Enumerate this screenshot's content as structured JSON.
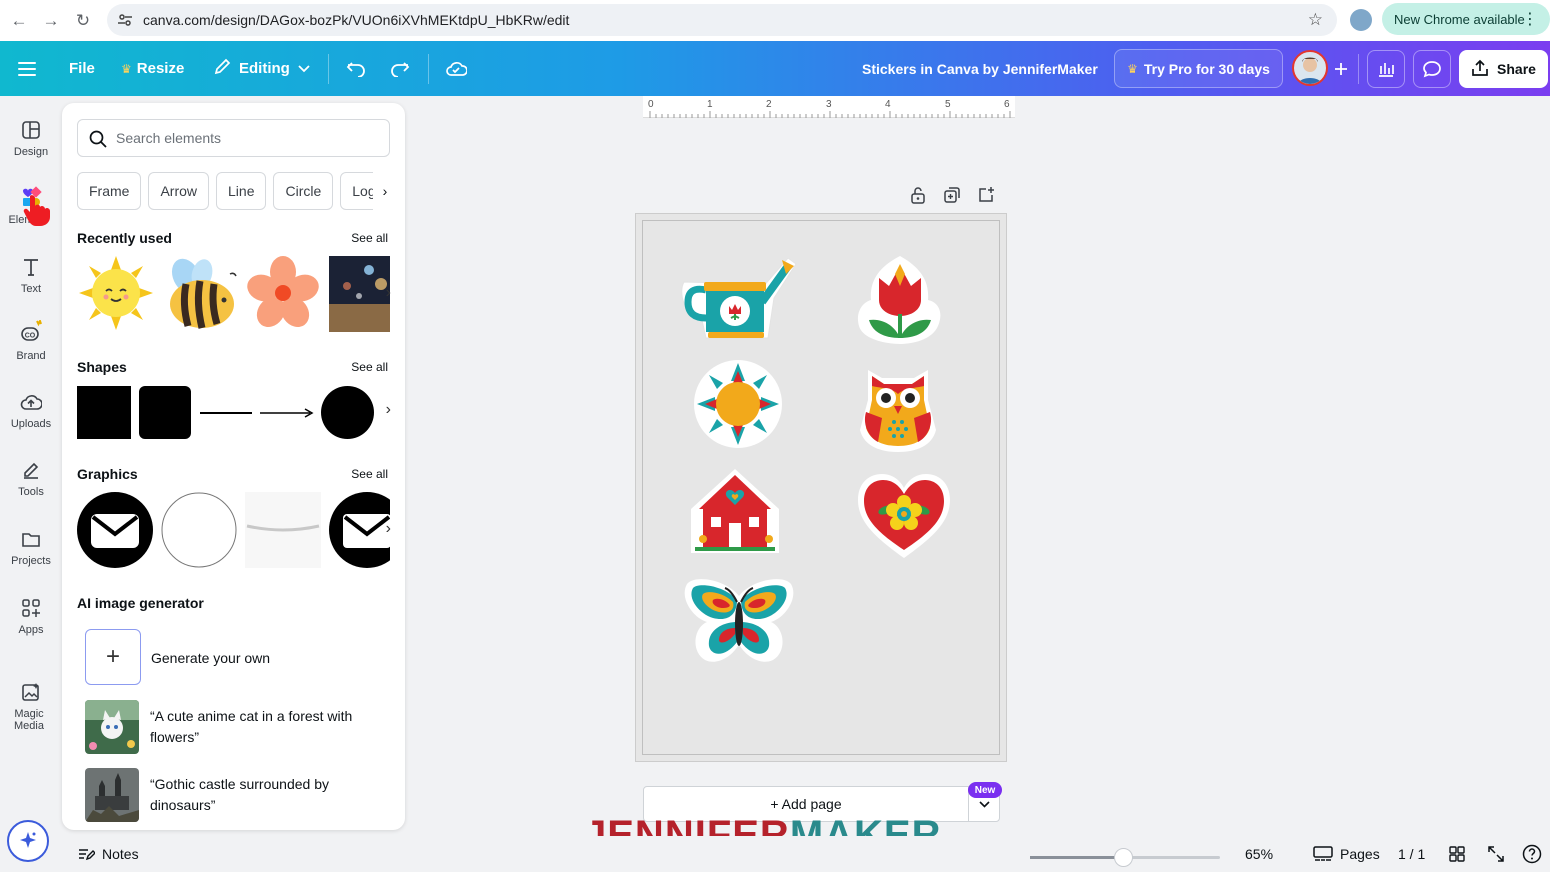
{
  "browser": {
    "url": "canva.com/design/DAGox-bozPk/VUOn6iXVhMEKtdpU_HbKRw/edit",
    "new_chrome_label": "New Chrome available"
  },
  "header": {
    "file_label": "File",
    "resize_label": "Resize",
    "editing_label": "Editing",
    "doc_title": "Stickers in Canva by JenniferMaker",
    "try_pro_label": "Try Pro for 30 days",
    "share_label": "Share"
  },
  "rail": {
    "items": [
      {
        "label": "Design",
        "icon": "design-icon"
      },
      {
        "label": "Elem",
        "icon": "elements-icon"
      },
      {
        "label": "Text",
        "icon": "text-icon"
      },
      {
        "label": "Brand",
        "icon": "brand-icon"
      },
      {
        "label": "Uploads",
        "icon": "uploads-icon"
      },
      {
        "label": "Tools",
        "icon": "tools-icon"
      },
      {
        "label": "Projects",
        "icon": "projects-icon"
      },
      {
        "label": "Apps",
        "icon": "apps-icon"
      },
      {
        "label": "Magic Media",
        "icon": "magic-media-icon"
      }
    ]
  },
  "panel": {
    "search_placeholder": "Search elements",
    "chips": [
      "Frame",
      "Arrow",
      "Line",
      "Circle",
      "Logo"
    ],
    "recently_used": {
      "title": "Recently used",
      "see_all": "See all"
    },
    "shapes": {
      "title": "Shapes",
      "see_all": "See all"
    },
    "graphics": {
      "title": "Graphics",
      "see_all": "See all"
    },
    "ai": {
      "title": "AI image generator",
      "generate_label": "Generate your own",
      "prompts": [
        "“A cute anime cat in a forest with flowers”",
        "“Gothic castle surrounded by dinosaurs”"
      ]
    }
  },
  "canvas": {
    "ruler_ticks": [
      "0",
      "1",
      "2",
      "3",
      "4",
      "5",
      "6"
    ],
    "add_page_label": "+ Add page",
    "new_badge": "New",
    "watermark_part1": "JENNIFER",
    "watermark_part2": "MAKER"
  },
  "footer": {
    "notes_label": "Notes",
    "zoom_value": "65%",
    "pages_label": "Pages",
    "page_count": "1 / 1"
  },
  "colors": {
    "accent": "#7a2ff0",
    "watermark_red": "#b5222b",
    "watermark_teal": "#2a8a8c"
  }
}
